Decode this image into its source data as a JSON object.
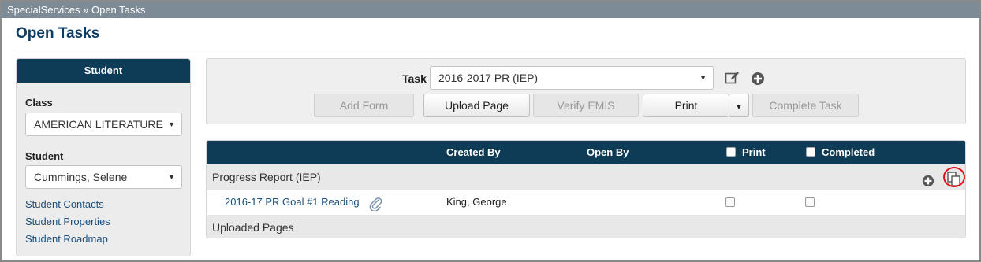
{
  "breadcrumb": {
    "app": "SpecialServices",
    "separator": "»",
    "current": "Open Tasks"
  },
  "page_title": "Open Tasks",
  "sidebar": {
    "header": "Student",
    "class_label": "Class",
    "class_value": "AMERICAN LITERATURE",
    "student_label": "Student",
    "student_value": "Cummings, Selene",
    "links": [
      "Student Contacts",
      "Student Properties",
      "Student Roadmap"
    ]
  },
  "task": {
    "label": "Task",
    "value": "2016-2017 PR (IEP)",
    "buttons": {
      "add_form": "Add Form",
      "upload_page": "Upload Page",
      "verify_emis": "Verify EMIS",
      "print": "Print",
      "complete_task": "Complete Task"
    }
  },
  "table": {
    "headers": {
      "created_by": "Created By",
      "open_by": "Open By",
      "print": "Print",
      "completed": "Completed"
    },
    "groups": [
      {
        "title": "Progress Report (IEP)",
        "rows": [
          {
            "name": "2016-17 PR Goal #1 Reading",
            "created_by": "King, George",
            "open_by": "",
            "print": false,
            "completed": false
          }
        ]
      },
      {
        "title": "Uploaded Pages",
        "rows": []
      }
    ]
  },
  "colors": {
    "header_navy": "#0e3c56",
    "title_blue": "#0e3c63",
    "link_blue": "#1d4f7c",
    "highlight_red": "#e0121a",
    "topbar_gray": "#7d8b97"
  },
  "icons": {
    "edit": "edit-icon",
    "add": "plus-circle-icon",
    "copy": "copy-pages-icon",
    "attachment": "paperclip-icon",
    "dropdown": "caret-down-icon"
  }
}
